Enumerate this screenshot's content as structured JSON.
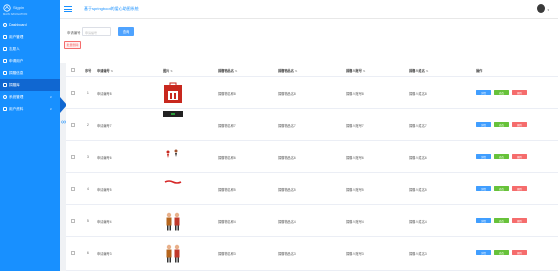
{
  "app": {
    "logo_text": "Sigpin",
    "nav_header": "MAIN NAVIGATION",
    "title": "基于springboot的爱心助图系统"
  },
  "colors": {
    "primary": "#1890ff",
    "active": "#1067d1",
    "danger": "#f56c6c",
    "success": "#67c23a"
  },
  "sidebar": {
    "items": [
      {
        "label": "Dashboard",
        "icon": "dashboard-icon"
      },
      {
        "label": "用户管理",
        "icon": "user-icon"
      },
      {
        "label": "志愿人",
        "icon": "user-icon"
      },
      {
        "label": "申请用户",
        "icon": "form-icon"
      },
      {
        "label": "捐赠信息",
        "icon": "document-icon"
      },
      {
        "label": "捐赠库",
        "icon": "box-icon"
      },
      {
        "label": "系统管理",
        "icon": "setting-icon",
        "has_children": true
      },
      {
        "label": "用户资料",
        "icon": "profile-icon",
        "has_children": true
      }
    ],
    "active_index": 5
  },
  "search": {
    "label": "申请编号",
    "placeholder": "申请编号",
    "button": "查询",
    "batch_delete": "批量删除"
  },
  "table": {
    "headers": {
      "index": "序号",
      "code": "申请编号",
      "image": "图片",
      "name": "捐赠物品名",
      "category": "捐赠物品名",
      "account": "捐赠人账号",
      "person": "捐赠人姓名",
      "ops": "操作"
    },
    "rows": [
      {
        "index": "1",
        "code": "申请编号8",
        "name": "捐赠物名称8",
        "category": "捐赠物品名8",
        "account": "捐赠人账号8",
        "person": "捐赠人姓名8",
        "pic": "bag"
      },
      {
        "index": "2",
        "code": "申请编号7",
        "name": "捐赠物名称7",
        "category": "捐赠物品名7",
        "account": "捐赠人账号7",
        "person": "捐赠人姓名7",
        "pic": "box"
      },
      {
        "index": "3",
        "code": "申请编号6",
        "name": "捐赠物名称6",
        "category": "捐赠物品名6",
        "account": "捐赠人账号6",
        "person": "捐赠人姓名6",
        "pic": "figures"
      },
      {
        "index": "4",
        "code": "申请编号5",
        "name": "捐赠物名称5",
        "category": "捐赠物品名5",
        "account": "捐赠人账号5",
        "person": "捐赠人姓名5",
        "pic": "text"
      },
      {
        "index": "5",
        "code": "申请编号4",
        "name": "捐赠物名称4",
        "category": "捐赠物品名4",
        "account": "捐赠人账号4",
        "person": "捐赠人姓名4",
        "pic": "people"
      },
      {
        "index": "6",
        "code": "申请编号3",
        "name": "捐赠物名称3",
        "category": "捐赠物品名3",
        "account": "捐赠人账号3",
        "person": "捐赠人姓名3",
        "pic": "people"
      }
    ],
    "actions": {
      "detail": "详情",
      "edit": "修改",
      "delete": "删除"
    }
  }
}
